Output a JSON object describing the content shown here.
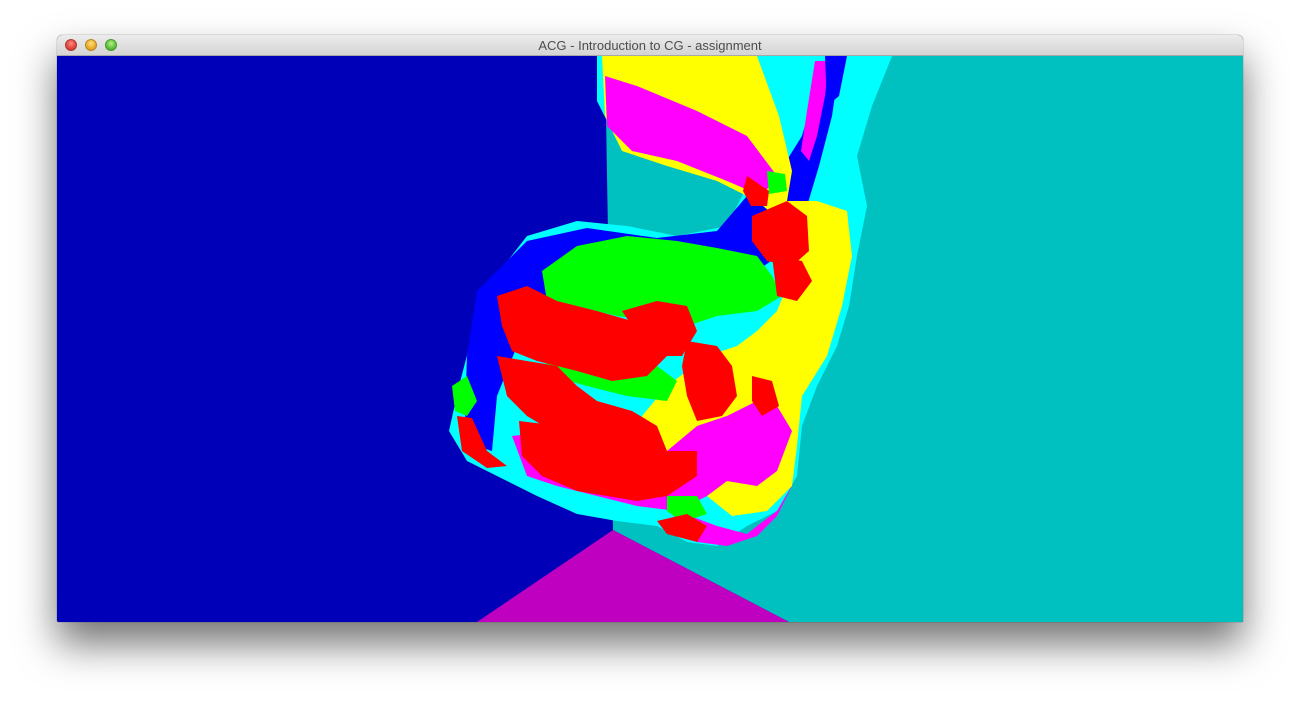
{
  "window": {
    "title": "ACG - Introduction to CG - assignment",
    "controls": [
      "close-button",
      "minimize-button",
      "zoom-button"
    ]
  },
  "scene": {
    "description_icon": "bunny-render",
    "colors": {
      "left_wall": "#0000b8",
      "right_wall": "#00c0c0",
      "floor": "#c000c0",
      "red": "#ff0000",
      "green": "#00ff00",
      "yellow": "#ffff00",
      "magenta": "#ff00ff",
      "cyan": "#00ffff",
      "blue": "#0000ff"
    }
  }
}
